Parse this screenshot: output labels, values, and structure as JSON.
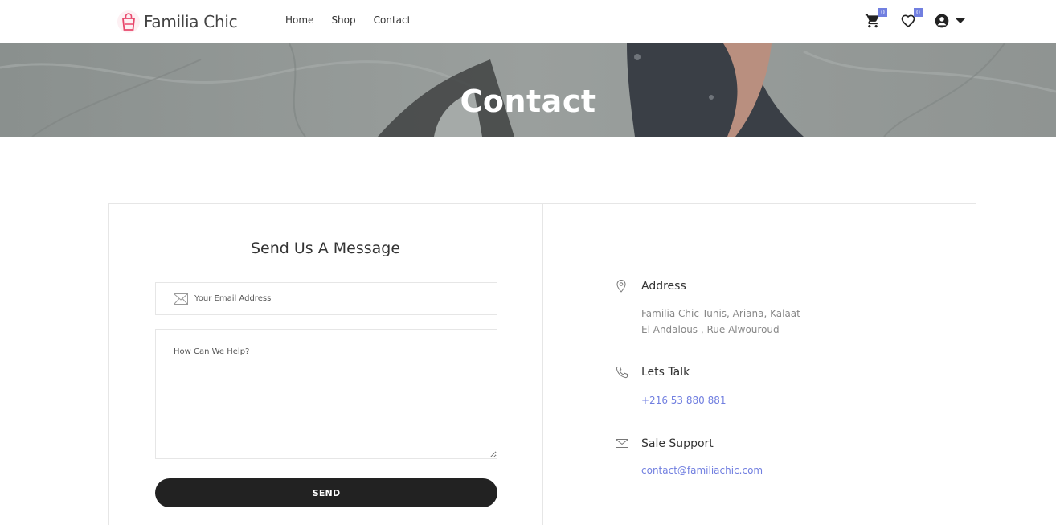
{
  "brand": {
    "name": "Familia Chic"
  },
  "nav": {
    "items": [
      {
        "label": "Home"
      },
      {
        "label": "Shop"
      },
      {
        "label": "Contact"
      }
    ]
  },
  "header_icons": {
    "cart_count": "0",
    "wishlist_count": "0"
  },
  "banner": {
    "title": "Contact"
  },
  "form": {
    "title": "Send Us A Message",
    "email_placeholder": "Your Email Address",
    "message_placeholder": "How Can We Help?",
    "send_label": "SEND"
  },
  "info": {
    "address": {
      "title": "Address",
      "line1": "Familia Chic Tunis, Ariana, Kalaat",
      "line2": "El Andalous , Rue Alwouroud"
    },
    "talk": {
      "title": "Lets Talk",
      "phone": "+216 53 880 881"
    },
    "support": {
      "title": "Sale Support",
      "email": "contact@familiachic.com"
    }
  },
  "colors": {
    "accent": "#717fe0",
    "button": "#222222",
    "border": "#e6e6e6"
  }
}
